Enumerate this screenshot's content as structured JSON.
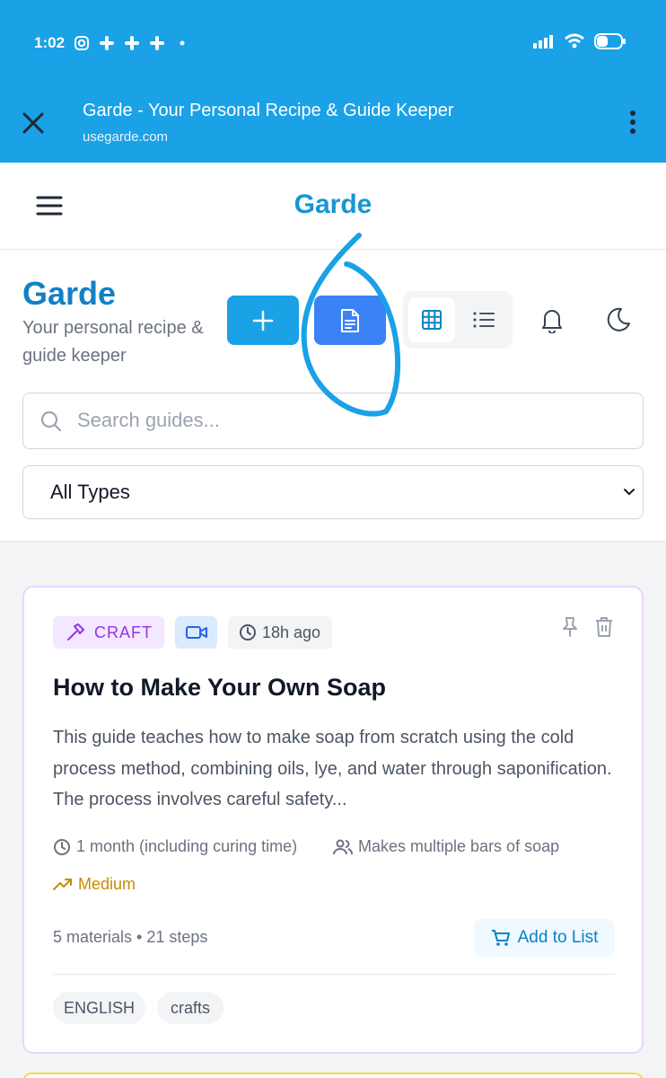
{
  "status_bar": {
    "time": "1:02"
  },
  "browser": {
    "title": "Garde - Your Personal Recipe & Guide Keeper",
    "url": "usegarde.com"
  },
  "nav": {
    "brand": "Garde"
  },
  "header": {
    "title": "Garde",
    "subtitle": "Your personal recipe & guide keeper",
    "search_placeholder": "Search guides...",
    "filter_selected": "All Types",
    "view_mode": "grid"
  },
  "card": {
    "type_badge": "CRAFT",
    "time_ago": "18h ago",
    "title": "How to Make Your Own Soap",
    "description": "This guide teaches how to make soap from scratch using the cold process method, combining oils, lye, and water through saponification. The process involves careful safety...",
    "duration": "1 month (including curing time)",
    "yield": "Makes multiple bars of soap",
    "difficulty": "Medium",
    "counts": "5 materials • 21 steps",
    "add_to_list_label": "Add to List",
    "tags": [
      "ENGLISH",
      "crafts"
    ]
  },
  "colors": {
    "accent": "#1aa1e6",
    "brand": "#1280c4",
    "craft": "#9333ea",
    "difficulty": "#ca8a04"
  }
}
